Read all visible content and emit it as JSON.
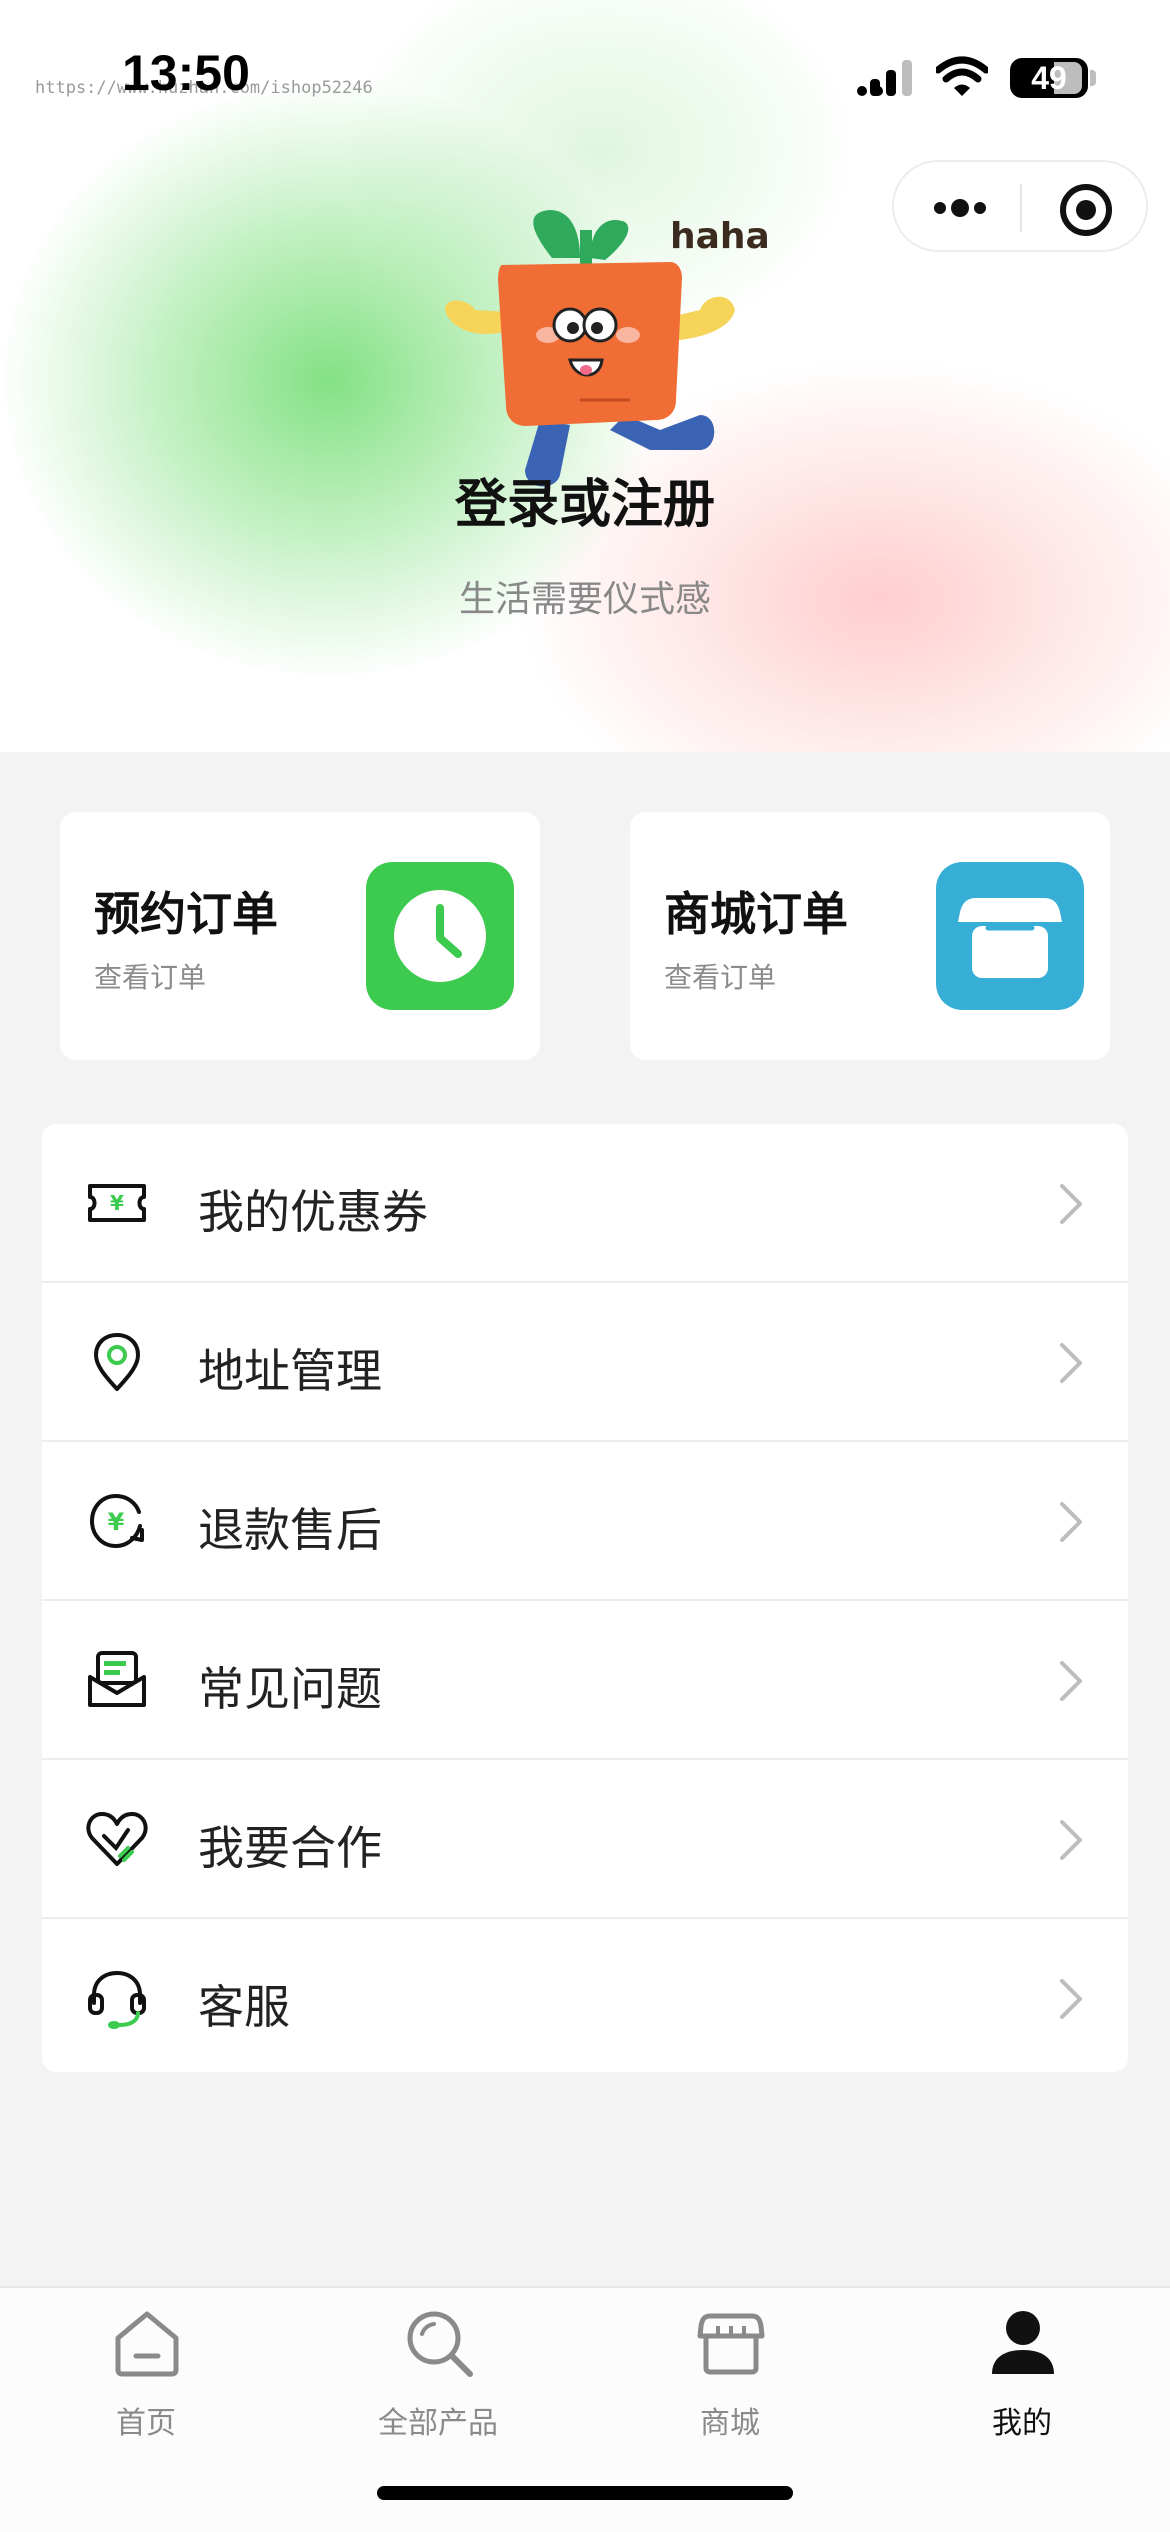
{
  "status_bar": {
    "time": "13:50",
    "battery": "49",
    "url_watermark": "https://www.huzhan.com/ishop52246"
  },
  "profile": {
    "login_title": "登录或注册",
    "slogan": "生活需要仪式感",
    "mascot_text": "haha"
  },
  "orders": [
    {
      "title": "预约订单",
      "subtitle": "查看订单",
      "icon": "clock-icon",
      "color": "#3ccb4f"
    },
    {
      "title": "商城订单",
      "subtitle": "查看订单",
      "icon": "store-icon",
      "color": "#36aed6"
    }
  ],
  "menu": [
    {
      "label": "我的优惠券",
      "icon": "coupon-icon"
    },
    {
      "label": "地址管理",
      "icon": "location-icon"
    },
    {
      "label": "退款售后",
      "icon": "refund-icon"
    },
    {
      "label": "常见问题",
      "icon": "faq-icon"
    },
    {
      "label": "我要合作",
      "icon": "cooperation-icon"
    },
    {
      "label": "客服",
      "icon": "headset-icon"
    }
  ],
  "tabs": [
    {
      "label": "首页",
      "icon": "home-icon",
      "active": false
    },
    {
      "label": "全部产品",
      "icon": "search-icon",
      "active": false
    },
    {
      "label": "商城",
      "icon": "store-icon",
      "active": false
    },
    {
      "label": "我的",
      "icon": "user-icon",
      "active": true
    }
  ],
  "colors": {
    "accent_green": "#3ccb4f",
    "accent_blue": "#36aed6",
    "page_background": "#f3f3f3"
  }
}
